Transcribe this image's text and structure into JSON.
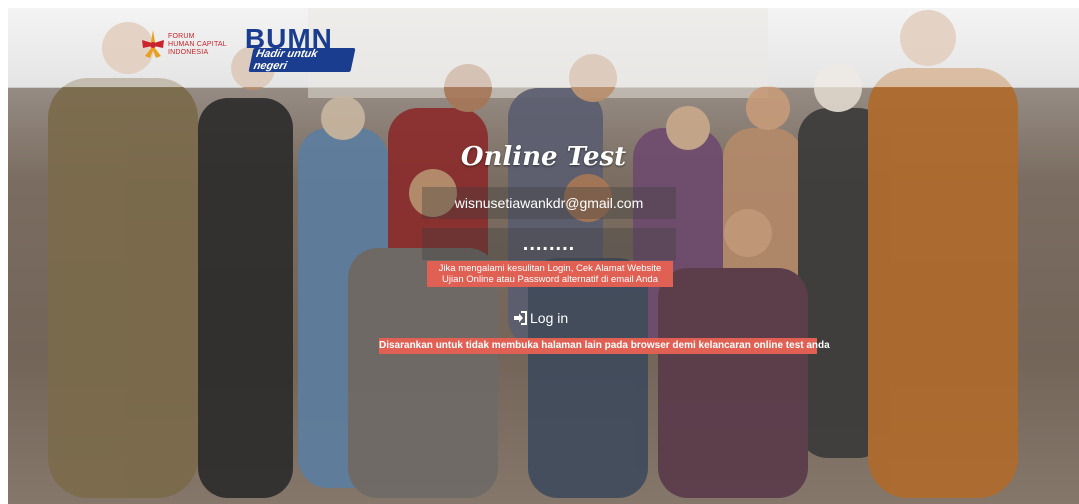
{
  "header": {
    "fhc_logo_text": [
      "FORUM",
      "HUMAN CAPITAL",
      "INDONESIA"
    ],
    "bumn_logo_text": "BUMN",
    "bumn_tagline": "Hadir untuk negeri"
  },
  "login": {
    "title": "Online Test",
    "email_value": "wisnusetiawankdr@gmail.com",
    "password_value": "........",
    "help_text": "Jika mengalami kesulitan Login, Cek Alamat Website Ujian Online atau Password alternatif di email Anda",
    "login_label": "Log in",
    "notice_text": "Disarankan untuk tidak membuka halaman lain pada browser demi kelancaran online test anda"
  },
  "colors": {
    "accent_red": "#e06054",
    "bumn_blue": "#1a3d8f",
    "fhc_red": "#c9252b"
  }
}
